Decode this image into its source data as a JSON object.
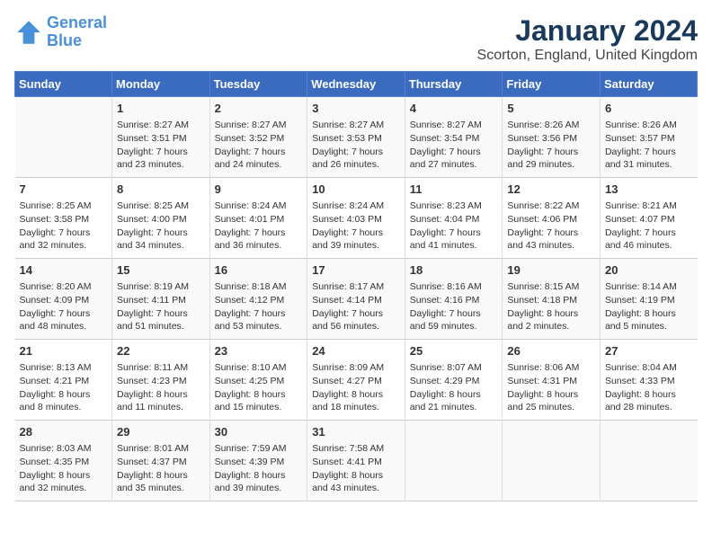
{
  "logo": {
    "line1": "General",
    "line2": "Blue"
  },
  "title": "January 2024",
  "subtitle": "Scorton, England, United Kingdom",
  "days_of_week": [
    "Sunday",
    "Monday",
    "Tuesday",
    "Wednesday",
    "Thursday",
    "Friday",
    "Saturday"
  ],
  "weeks": [
    [
      {
        "day": "",
        "info": ""
      },
      {
        "day": "1",
        "info": "Sunrise: 8:27 AM\nSunset: 3:51 PM\nDaylight: 7 hours\nand 23 minutes."
      },
      {
        "day": "2",
        "info": "Sunrise: 8:27 AM\nSunset: 3:52 PM\nDaylight: 7 hours\nand 24 minutes."
      },
      {
        "day": "3",
        "info": "Sunrise: 8:27 AM\nSunset: 3:53 PM\nDaylight: 7 hours\nand 26 minutes."
      },
      {
        "day": "4",
        "info": "Sunrise: 8:27 AM\nSunset: 3:54 PM\nDaylight: 7 hours\nand 27 minutes."
      },
      {
        "day": "5",
        "info": "Sunrise: 8:26 AM\nSunset: 3:56 PM\nDaylight: 7 hours\nand 29 minutes."
      },
      {
        "day": "6",
        "info": "Sunrise: 8:26 AM\nSunset: 3:57 PM\nDaylight: 7 hours\nand 31 minutes."
      }
    ],
    [
      {
        "day": "7",
        "info": "Sunrise: 8:25 AM\nSunset: 3:58 PM\nDaylight: 7 hours\nand 32 minutes."
      },
      {
        "day": "8",
        "info": "Sunrise: 8:25 AM\nSunset: 4:00 PM\nDaylight: 7 hours\nand 34 minutes."
      },
      {
        "day": "9",
        "info": "Sunrise: 8:24 AM\nSunset: 4:01 PM\nDaylight: 7 hours\nand 36 minutes."
      },
      {
        "day": "10",
        "info": "Sunrise: 8:24 AM\nSunset: 4:03 PM\nDaylight: 7 hours\nand 39 minutes."
      },
      {
        "day": "11",
        "info": "Sunrise: 8:23 AM\nSunset: 4:04 PM\nDaylight: 7 hours\nand 41 minutes."
      },
      {
        "day": "12",
        "info": "Sunrise: 8:22 AM\nSunset: 4:06 PM\nDaylight: 7 hours\nand 43 minutes."
      },
      {
        "day": "13",
        "info": "Sunrise: 8:21 AM\nSunset: 4:07 PM\nDaylight: 7 hours\nand 46 minutes."
      }
    ],
    [
      {
        "day": "14",
        "info": "Sunrise: 8:20 AM\nSunset: 4:09 PM\nDaylight: 7 hours\nand 48 minutes."
      },
      {
        "day": "15",
        "info": "Sunrise: 8:19 AM\nSunset: 4:11 PM\nDaylight: 7 hours\nand 51 minutes."
      },
      {
        "day": "16",
        "info": "Sunrise: 8:18 AM\nSunset: 4:12 PM\nDaylight: 7 hours\nand 53 minutes."
      },
      {
        "day": "17",
        "info": "Sunrise: 8:17 AM\nSunset: 4:14 PM\nDaylight: 7 hours\nand 56 minutes."
      },
      {
        "day": "18",
        "info": "Sunrise: 8:16 AM\nSunset: 4:16 PM\nDaylight: 7 hours\nand 59 minutes."
      },
      {
        "day": "19",
        "info": "Sunrise: 8:15 AM\nSunset: 4:18 PM\nDaylight: 8 hours\nand 2 minutes."
      },
      {
        "day": "20",
        "info": "Sunrise: 8:14 AM\nSunset: 4:19 PM\nDaylight: 8 hours\nand 5 minutes."
      }
    ],
    [
      {
        "day": "21",
        "info": "Sunrise: 8:13 AM\nSunset: 4:21 PM\nDaylight: 8 hours\nand 8 minutes."
      },
      {
        "day": "22",
        "info": "Sunrise: 8:11 AM\nSunset: 4:23 PM\nDaylight: 8 hours\nand 11 minutes."
      },
      {
        "day": "23",
        "info": "Sunrise: 8:10 AM\nSunset: 4:25 PM\nDaylight: 8 hours\nand 15 minutes."
      },
      {
        "day": "24",
        "info": "Sunrise: 8:09 AM\nSunset: 4:27 PM\nDaylight: 8 hours\nand 18 minutes."
      },
      {
        "day": "25",
        "info": "Sunrise: 8:07 AM\nSunset: 4:29 PM\nDaylight: 8 hours\nand 21 minutes."
      },
      {
        "day": "26",
        "info": "Sunrise: 8:06 AM\nSunset: 4:31 PM\nDaylight: 8 hours\nand 25 minutes."
      },
      {
        "day": "27",
        "info": "Sunrise: 8:04 AM\nSunset: 4:33 PM\nDaylight: 8 hours\nand 28 minutes."
      }
    ],
    [
      {
        "day": "28",
        "info": "Sunrise: 8:03 AM\nSunset: 4:35 PM\nDaylight: 8 hours\nand 32 minutes."
      },
      {
        "day": "29",
        "info": "Sunrise: 8:01 AM\nSunset: 4:37 PM\nDaylight: 8 hours\nand 35 minutes."
      },
      {
        "day": "30",
        "info": "Sunrise: 7:59 AM\nSunset: 4:39 PM\nDaylight: 8 hours\nand 39 minutes."
      },
      {
        "day": "31",
        "info": "Sunrise: 7:58 AM\nSunset: 4:41 PM\nDaylight: 8 hours\nand 43 minutes."
      },
      {
        "day": "",
        "info": ""
      },
      {
        "day": "",
        "info": ""
      },
      {
        "day": "",
        "info": ""
      }
    ]
  ]
}
